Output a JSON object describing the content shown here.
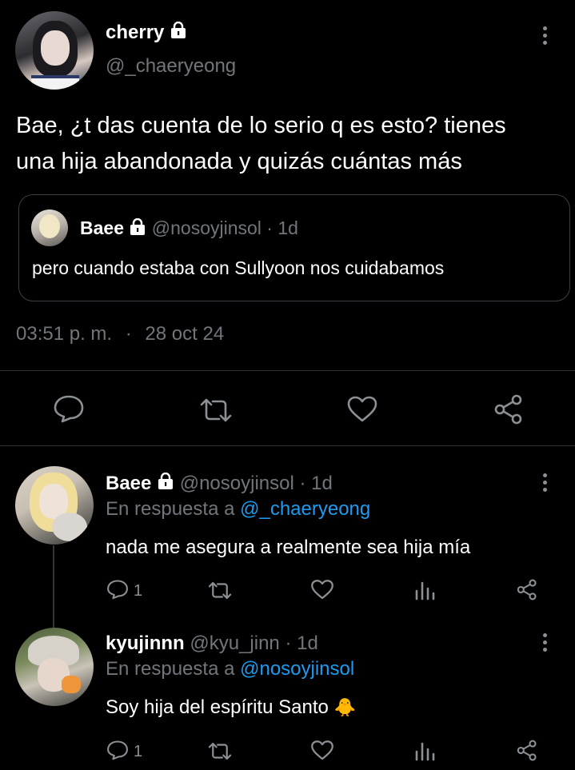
{
  "main_tweet": {
    "display_name": "cherry",
    "handle": "@_chaeryeong",
    "text_line1": "Bae, ¿t das cuenta de lo serio q es esto? tienes",
    "text_line2": "una hija abandonada y quizás cuántas más",
    "time": "03:51 p. m.",
    "separator": "·",
    "date": "28 oct 24",
    "quoted": {
      "display_name": "Baee",
      "handle": "@nosoyjinsol",
      "age": "· 1d",
      "text": "pero cuando estaba con Sullyoon nos cuidabamos"
    }
  },
  "replies": [
    {
      "display_name": "Baee",
      "handle": "@nosoyjinsol",
      "age": "· 1d",
      "reply_prefix": "En respuesta a",
      "reply_to": "@_chaeryeong",
      "text": "nada me asegura a realmente sea hija mía",
      "reply_count": "1",
      "emoji": ""
    },
    {
      "display_name": "kyujinnn",
      "handle": "@kyu_jinn",
      "age": "· 1d",
      "reply_prefix": "En respuesta a",
      "reply_to": "@nosoyjinsol",
      "text": "Soy hija del espíritu Santo",
      "reply_count": "1",
      "emoji": "🐥"
    }
  ],
  "colors": {
    "background": "#000000",
    "text": "#e7e9ea",
    "muted": "#71767b",
    "link": "#1d9bf0",
    "divider": "#2f3336"
  }
}
